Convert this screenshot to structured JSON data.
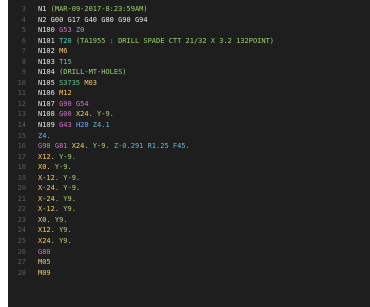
{
  "editor": {
    "lines": [
      {
        "num": "3",
        "tokens": [
          {
            "t": "N1",
            "c": "w"
          },
          {
            "t": " (MAR-09-2017-8:23:59AM)",
            "c": "c"
          }
        ]
      },
      {
        "num": "4",
        "tokens": [
          {
            "t": "N2 ",
            "c": "w"
          },
          {
            "t": "G00 G17 G40 G80 G90 G94",
            "c": "w"
          }
        ]
      },
      {
        "num": "5",
        "tokens": [
          {
            "t": "N100 ",
            "c": "w"
          },
          {
            "t": "G53 ",
            "c": "g"
          },
          {
            "t": "Z0",
            "c": "z"
          }
        ]
      },
      {
        "num": "6",
        "tokens": [
          {
            "t": "N101 ",
            "c": "w"
          },
          {
            "t": "T20 ",
            "c": "t"
          },
          {
            "t": "(TA1955 : DRILL SPADE CTT 21/32 X 3.2 132POINT)",
            "c": "c"
          }
        ]
      },
      {
        "num": "7",
        "tokens": [
          {
            "t": "N102 ",
            "c": "w"
          },
          {
            "t": "M6",
            "c": "m"
          }
        ]
      },
      {
        "num": "8",
        "tokens": [
          {
            "t": "N103 ",
            "c": "w"
          },
          {
            "t": "T15",
            "c": "t"
          }
        ]
      },
      {
        "num": "9",
        "tokens": [
          {
            "t": "N104 ",
            "c": "w"
          },
          {
            "t": "(DRILL-MT-HOLES)",
            "c": "c"
          }
        ]
      },
      {
        "num": "10",
        "tokens": [
          {
            "t": "N105 ",
            "c": "w"
          },
          {
            "t": "S3735 ",
            "c": "s"
          },
          {
            "t": "M03",
            "c": "m"
          }
        ]
      },
      {
        "num": "11",
        "tokens": [
          {
            "t": "N106 ",
            "c": "w"
          },
          {
            "t": "M12",
            "c": "m"
          }
        ]
      },
      {
        "num": "12",
        "tokens": [
          {
            "t": "N107 ",
            "c": "w"
          },
          {
            "t": "G90 G54",
            "c": "g"
          }
        ]
      },
      {
        "num": "13",
        "tokens": [
          {
            "t": "N108 ",
            "c": "w"
          },
          {
            "t": "G00 ",
            "c": "g"
          },
          {
            "t": "X24. ",
            "c": "x"
          },
          {
            "t": "Y-9.",
            "c": "y"
          }
        ]
      },
      {
        "num": "14",
        "tokens": [
          {
            "t": "N109 ",
            "c": "w"
          },
          {
            "t": "G43 ",
            "c": "g"
          },
          {
            "t": "H20 ",
            "c": "h"
          },
          {
            "t": "Z4.1",
            "c": "z"
          }
        ]
      },
      {
        "num": "15",
        "tokens": [
          {
            "t": "Z4.",
            "c": "z"
          }
        ]
      },
      {
        "num": "16",
        "tokens": [
          {
            "t": "G98 G81 ",
            "c": "g"
          },
          {
            "t": "X24. ",
            "c": "x"
          },
          {
            "t": "Y-9. ",
            "c": "y"
          },
          {
            "t": "Z-0.291 R1.25 F45.",
            "c": "z"
          }
        ]
      },
      {
        "num": "17",
        "tokens": [
          {
            "t": "X12. ",
            "c": "x"
          },
          {
            "t": "Y-9.",
            "c": "y"
          }
        ]
      },
      {
        "num": "18",
        "tokens": [
          {
            "t": "X0. ",
            "c": "x"
          },
          {
            "t": "Y-9.",
            "c": "y"
          }
        ]
      },
      {
        "num": "19",
        "tokens": [
          {
            "t": "X-12. ",
            "c": "x"
          },
          {
            "t": "Y-9.",
            "c": "y"
          }
        ]
      },
      {
        "num": "20",
        "tokens": [
          {
            "t": "X-24. ",
            "c": "x"
          },
          {
            "t": "Y-9.",
            "c": "y"
          }
        ]
      },
      {
        "num": "21",
        "tokens": [
          {
            "t": "X-24. ",
            "c": "x"
          },
          {
            "t": "Y9.",
            "c": "y"
          }
        ]
      },
      {
        "num": "22",
        "tokens": [
          {
            "t": "X-12. ",
            "c": "x"
          },
          {
            "t": "Y9.",
            "c": "y"
          }
        ]
      },
      {
        "num": "23",
        "tokens": [
          {
            "t": "X0. ",
            "c": "x"
          },
          {
            "t": "Y9.",
            "c": "y"
          }
        ]
      },
      {
        "num": "24",
        "tokens": [
          {
            "t": "X12. ",
            "c": "x"
          },
          {
            "t": "Y9.",
            "c": "y"
          }
        ]
      },
      {
        "num": "25",
        "tokens": [
          {
            "t": "X24. ",
            "c": "x"
          },
          {
            "t": "Y9.",
            "c": "y"
          }
        ]
      },
      {
        "num": "26",
        "tokens": [
          {
            "t": "G80",
            "c": "g"
          }
        ]
      },
      {
        "num": "27",
        "tokens": [
          {
            "t": "M05",
            "c": "m"
          }
        ]
      },
      {
        "num": "28",
        "tokens": [
          {
            "t": "M09",
            "c": "m"
          }
        ]
      }
    ]
  },
  "colors": {
    "background": "#1e1e1e",
    "line_number": "#5a5a5a",
    "g_code": "#d56ec9",
    "x_coord": "#f4c95d",
    "y_coord": "#a7d17d",
    "z_coord": "#5fb9d9",
    "tool": "#4ec9b0",
    "comment": "#9bcf71",
    "m_code": "#f0c46a"
  }
}
